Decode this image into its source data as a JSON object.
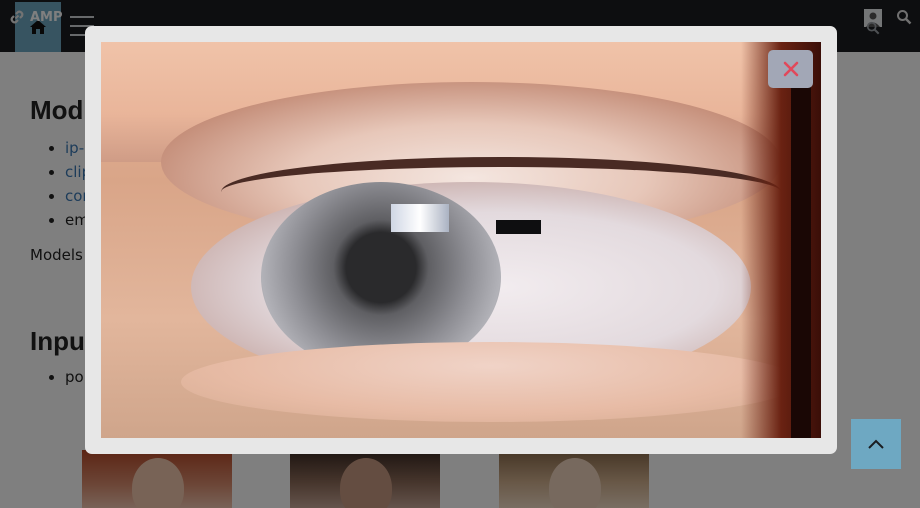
{
  "header": {
    "amp_label": "AMP"
  },
  "content": {
    "models_heading": "Mod",
    "model_items": [
      "ip-",
      "clip",
      "con",
      "em"
    ],
    "models_text": "Models",
    "inputs_heading": "Inpu",
    "input_items": [
      "po"
    ]
  },
  "modal": {
    "close_glyph": "✕"
  },
  "colors": {
    "accent": "#6ea8c2",
    "close_x": "#e1485a",
    "overlay": "rgba(0,0,0,0.5)"
  }
}
